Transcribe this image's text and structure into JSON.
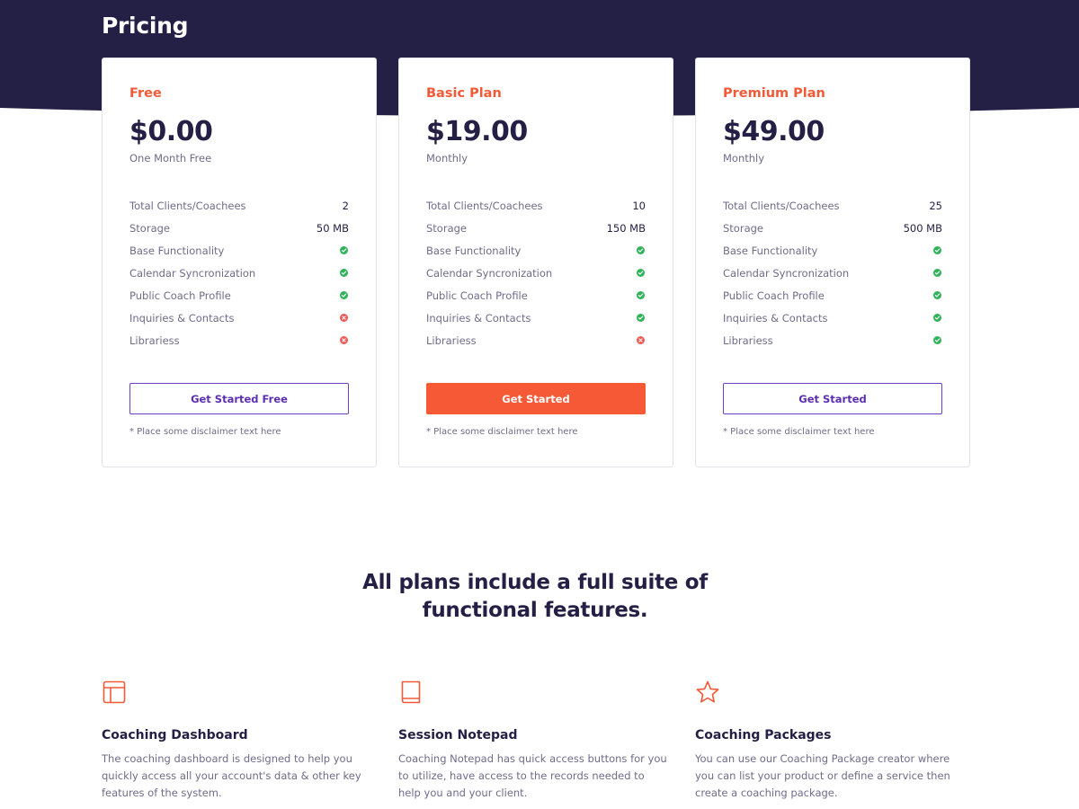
{
  "header": {
    "title": "Pricing"
  },
  "colors": {
    "navy": "#231f45",
    "accent": "#f55936",
    "purple": "#5b2fb0",
    "check": "#2fb45a",
    "cross": "#ec5b56"
  },
  "plans": [
    {
      "name": "Free",
      "price": "$0.00",
      "period": "One Month Free",
      "features": [
        {
          "label": "Total Clients/Coachees",
          "value": "2"
        },
        {
          "label": "Storage",
          "value": "50 MB"
        },
        {
          "label": "Base Functionality",
          "included": true
        },
        {
          "label": "Calendar Syncronization",
          "included": true
        },
        {
          "label": "Public Coach Profile",
          "included": true
        },
        {
          "label": "Inquiries & Contacts",
          "included": false
        },
        {
          "label": "Librariess",
          "included": false
        }
      ],
      "cta": "Get Started Free",
      "disclaimer": "* Place some disclaimer text here"
    },
    {
      "name": "Basic Plan",
      "price": "$19.00",
      "period": "Monthly",
      "features": [
        {
          "label": "Total Clients/Coachees",
          "value": "10"
        },
        {
          "label": "Storage",
          "value": "150 MB"
        },
        {
          "label": "Base Functionality",
          "included": true
        },
        {
          "label": "Calendar Syncronization",
          "included": true
        },
        {
          "label": "Public Coach Profile",
          "included": true
        },
        {
          "label": "Inquiries & Contacts",
          "included": true
        },
        {
          "label": "Librariess",
          "included": false
        }
      ],
      "cta": "Get Started",
      "disclaimer": "* Place some disclaimer text here"
    },
    {
      "name": "Premium Plan",
      "price": "$49.00",
      "period": "Monthly",
      "features": [
        {
          "label": "Total Clients/Coachees",
          "value": "25"
        },
        {
          "label": "Storage",
          "value": "500 MB"
        },
        {
          "label": "Base Functionality",
          "included": true
        },
        {
          "label": "Calendar Syncronization",
          "included": true
        },
        {
          "label": "Public Coach Profile",
          "included": true
        },
        {
          "label": "Inquiries & Contacts",
          "included": true
        },
        {
          "label": "Librariess",
          "included": true
        }
      ],
      "cta": "Get Started",
      "disclaimer": "* Place some disclaimer text here"
    }
  ],
  "features_section": {
    "heading": "All plans include a full suite of functional features.",
    "items": [
      {
        "icon": "dashboard-layout-icon",
        "title": "Coaching Dashboard",
        "description": "The coaching dashboard is designed to help you quickly access all your account's data & other key features of the system."
      },
      {
        "icon": "notepad-book-icon",
        "title": "Session Notepad",
        "description": "Coaching Notepad has quick access buttons for you to utilize, have access to the records needed to help you and your client."
      },
      {
        "icon": "star-icon",
        "title": "Coaching Packages",
        "description": "You can use our Coaching Package creator where you can list your product or define a service then create a coaching package."
      }
    ]
  }
}
